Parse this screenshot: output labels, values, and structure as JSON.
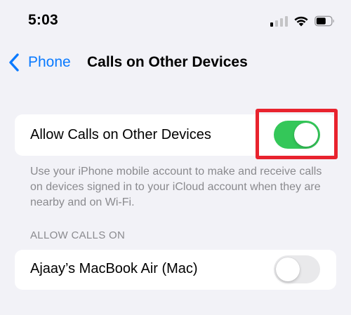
{
  "status_bar": {
    "time": "5:03",
    "icons": [
      "cellular-signal-icon",
      "wifi-icon",
      "battery-icon"
    ]
  },
  "nav": {
    "back_label": "Phone",
    "back_icon": "chevron-left-icon",
    "title": "Calls on Other Devices"
  },
  "allow_calls": {
    "label": "Allow Calls on Other Devices",
    "enabled": true
  },
  "footer": {
    "description": "Use your iPhone mobile account to make and receive calls on devices signed in to your iCloud account when they are nearby and on Wi-Fi."
  },
  "allow_calls_on": {
    "header": "ALLOW CALLS ON",
    "devices": [
      {
        "label": "Ajaay’s MacBook Air (Mac)",
        "enabled": false
      }
    ]
  },
  "colors": {
    "background": "#f2f2f7",
    "accent_blue": "#0a7aff",
    "toggle_on": "#34c759",
    "toggle_off": "#e9e9eb",
    "highlight_red": "#e8232e",
    "secondary_text": "#8a8a8e"
  }
}
